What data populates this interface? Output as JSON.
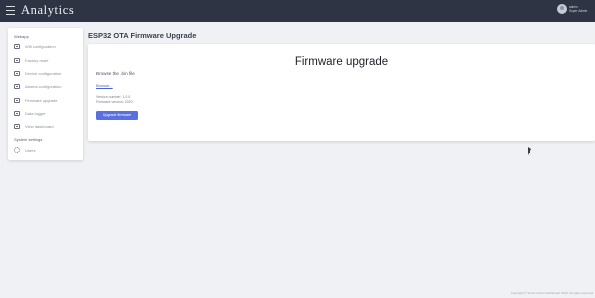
{
  "topbar": {
    "brand": "Analytics",
    "brand_sub": "",
    "user_name": "admin",
    "user_role": "Super Admin",
    "background": "#2e3443"
  },
  "sidebar": {
    "section1_title": "Webapp",
    "items": [
      {
        "label": "Wifi configuration",
        "icon": "settings-panel-icon"
      },
      {
        "label": "Factory reset",
        "icon": "settings-panel-icon"
      },
      {
        "label": "Device configuration",
        "icon": "settings-panel-icon"
      },
      {
        "label": "Alarms configuration",
        "icon": "settings-panel-icon"
      },
      {
        "label": "Firmware upgrade",
        "icon": "settings-panel-icon"
      },
      {
        "label": "Data logger",
        "icon": "settings-panel-icon"
      },
      {
        "label": "View dashboard",
        "icon": "settings-panel-icon"
      }
    ],
    "section2_title": "System settings",
    "settings_item": {
      "label": "Users",
      "icon": "gear-icon"
    }
  },
  "main": {
    "page_title": "ESP32 OTA Firmware Upgrade",
    "card_title": "Firmware upgrade",
    "browse_label": "Browse the .bin file",
    "file_link": "Browse...",
    "current_version": "Version number: 1.0.0",
    "current_date": "Firmware version: 2020",
    "upgrade_button": "Upgrade firmware",
    "accent": "#5a6fe0"
  },
  "footer": {
    "text": "Copyright © Smart Admin Dashboard 2020. All rights reserved."
  }
}
